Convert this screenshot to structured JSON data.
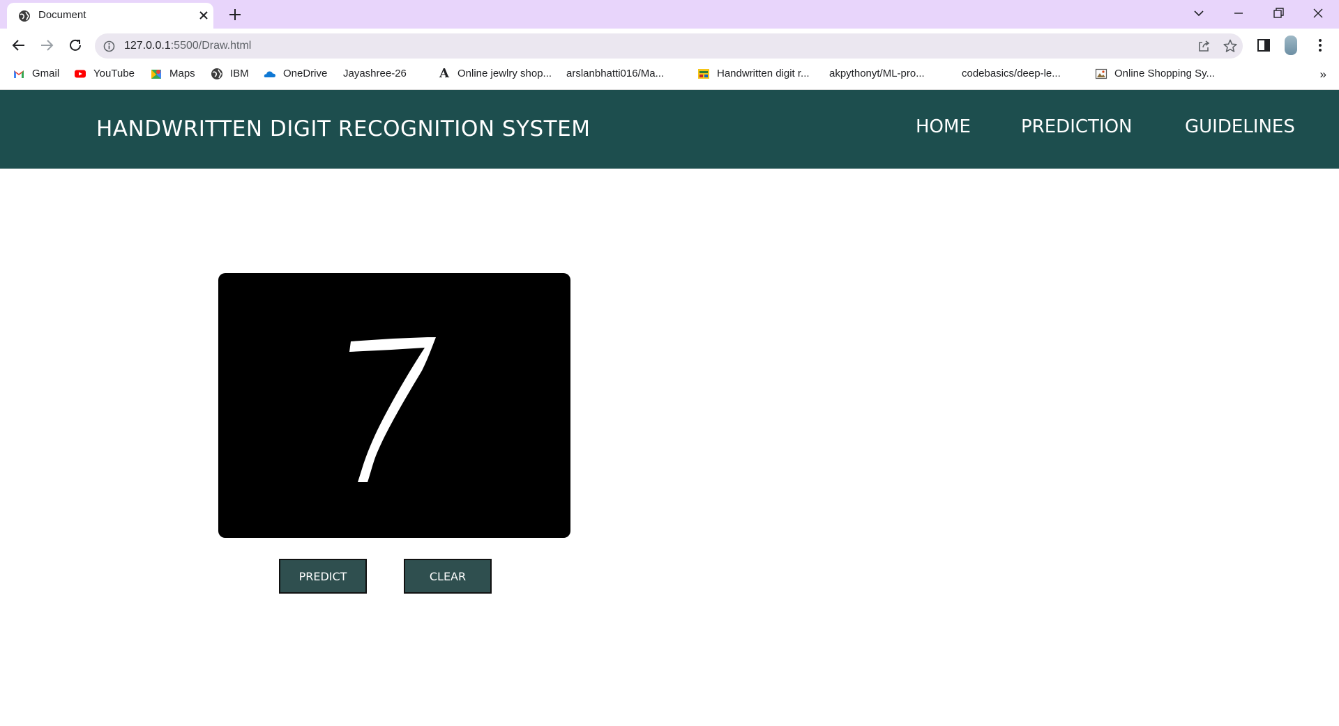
{
  "browser": {
    "tab": {
      "title": "Document"
    },
    "url": {
      "host": "127.0.0.1",
      "path": ":5500/Draw.html"
    },
    "bookmarks": [
      {
        "label": "Gmail",
        "icon": "gmail-icon"
      },
      {
        "label": "YouTube",
        "icon": "youtube-icon"
      },
      {
        "label": "Maps",
        "icon": "maps-icon"
      },
      {
        "label": "IBM",
        "icon": "globe-icon"
      },
      {
        "label": "OneDrive",
        "icon": "onedrive-icon"
      },
      {
        "label": "Jayashree-26",
        "icon": "github-icon"
      },
      {
        "label": "Online jewlry shop...",
        "icon": "font-a-icon"
      },
      {
        "label": "arslanbhatti016/Ma...",
        "icon": "github-icon"
      },
      {
        "label": "Handwritten digit r...",
        "icon": "image-icon"
      },
      {
        "label": "akpythonyt/ML-pro...",
        "icon": "github-icon"
      },
      {
        "label": "codebasics/deep-le...",
        "icon": "github-icon"
      },
      {
        "label": "Online Shopping Sy...",
        "icon": "image-icon"
      }
    ],
    "overflow": "»"
  },
  "site": {
    "title": "HANDWRITTEN DIGIT RECOGNITION SYSTEM",
    "nav": {
      "home": "HOME",
      "prediction": "PREDICTION",
      "guidelines": "GUIDELINES"
    },
    "header_color": "#1d4e4e"
  },
  "canvas": {
    "drawn_digit": "7",
    "background": "#000000",
    "stroke": "#ffffff"
  },
  "actions": {
    "predict": "PREDICT",
    "clear": "CLEAR",
    "button_color": "#2f4f4f"
  }
}
